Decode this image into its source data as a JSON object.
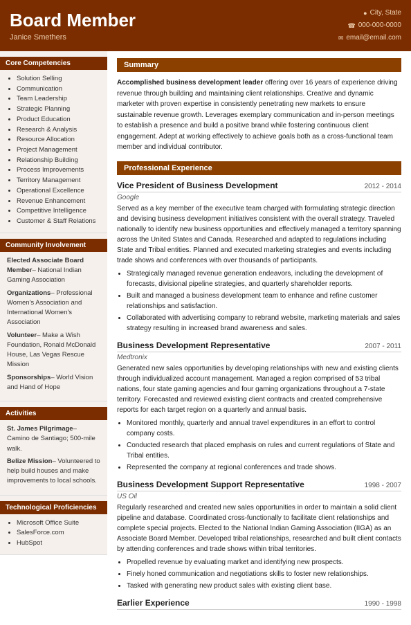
{
  "header": {
    "title": "Board Member",
    "name": "Janice Smethers",
    "location": "City, State",
    "phone": "000-000-0000",
    "email": "email@email.com"
  },
  "left": {
    "core_competencies": {
      "title": "Core Competencies",
      "items": [
        "Solution Selling",
        "Communication",
        "Team Leadership",
        "Strategic Planning",
        "Product Education",
        "Research & Analysis",
        "Resource Allocation",
        "Project Management",
        "Relationship Building",
        "Process Improvements",
        "Territory Management",
        "Operational Excellence",
        "Revenue Enhancement",
        "Competitive Intelligence",
        "Customer & Staff Relations"
      ]
    },
    "community_involvement": {
      "title": "Community Involvement",
      "items": [
        {
          "label": "Elected Associate Board Member",
          "detail": "– National Indian Gaming Association"
        },
        {
          "label": "Organizations",
          "detail": "– Professional Women's Association and International Women's Association"
        },
        {
          "label": "Volunteer",
          "detail": "– Make a Wish Foundation, Ronald McDonald House, Las Vegas Rescue Mission"
        },
        {
          "label": "Sponsorships",
          "detail": "– World Vision and Hand of Hope"
        }
      ]
    },
    "activities": {
      "title": "Activities",
      "items": [
        {
          "label": "St. James Pilgrimage",
          "detail": "– Camino de Santiago; 500-mile walk."
        },
        {
          "label": "Belize Mission",
          "detail": "– Volunteered to help build houses and make improvements to local schools."
        }
      ]
    },
    "tech": {
      "title": "Technological Proficiencies",
      "items": [
        "Microsoft Office Suite",
        "SalesForce.com",
        "HubSpot"
      ]
    }
  },
  "right": {
    "summary": {
      "title": "Summary",
      "bold_part": "Accomplished business development leader",
      "text": " offering over 16 years of experience driving revenue through building and maintaining client relationships. Creative and dynamic marketer with proven expertise in consistently penetrating new markets to ensure sustainable revenue growth. Leverages exemplary communication and in-person meetings to establish a presence and build a positive brand while fostering continuous client engagement. Adept at working effectively to achieve goals both as a cross-functional team member and individual contributor."
    },
    "experience": {
      "title": "Professional Experience",
      "jobs": [
        {
          "title": "Vice President of Business Development",
          "dates": "2012 - 2014",
          "company": "Google",
          "description": "Served as a key member of the executive team charged with formulating strategic direction and devising business development initiatives consistent with the overall strategy. Traveled nationally to identify new business opportunities and effectively managed a territory spanning across the United States and Canada. Researched and adapted to regulations including State and Tribal entities. Planned and executed marketing strategies and events including trade shows and conferences with over thousands of participants.",
          "bullets": [
            "Strategically managed revenue generation endeavors, including the development of forecasts, divisional pipeline strategies, and quarterly shareholder reports.",
            "Built and managed a business development team to enhance and refine customer relationships and satisfaction.",
            "Collaborated with advertising company to rebrand website, marketing materials and sales strategy resulting in increased brand awareness and sales."
          ]
        },
        {
          "title": "Business Development Representative",
          "dates": "2007 - 2011",
          "company": "Medtronix",
          "description": "Generated new sales opportunities by developing relationships with new and existing clients through individualized account management. Managed a region comprised of 53 tribal nations, four state gaming agencies and four gaming organizations throughout a 7-state territory. Forecasted and reviewed existing client contracts and created comprehensive reports for each target region on a quarterly and annual basis.",
          "bullets": [
            "Monitored monthly, quarterly and annual travel expenditures in an effort to control company costs.",
            "Conducted research that placed emphasis on rules and current regulations of State and Tribal entities.",
            "Represented the company at regional conferences and trade shows."
          ]
        },
        {
          "title": "Business Development Support Representative",
          "dates": "1998 - 2007",
          "company": "US Oil",
          "description": "Regularly researched and created new sales opportunities in order to maintain a solid client pipeline and database. Coordinated cross-functionally to facilitate client relationships and complete special projects. Elected to the National Indian Gaming Association (IIGA) as an Associate Board Member. Developed tribal relationships, researched and built client contacts by attending conferences and trade shows within tribal territories.",
          "bullets": [
            "Propelled revenue by evaluating market and identifying new prospects.",
            "Finely honed communication and negotiations skills to foster new relationships.",
            "Tasked with generating new product sales with existing client base."
          ]
        },
        {
          "title": "Earlier Experience",
          "dates": "1990 - 1998",
          "company": "",
          "description": "",
          "bullets": []
        }
      ]
    }
  }
}
